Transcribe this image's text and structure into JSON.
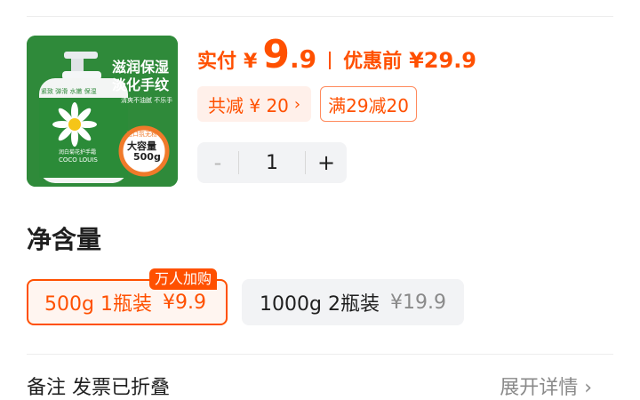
{
  "product": {
    "image_text": {
      "headline_1": "滋润保湿",
      "headline_2": "淡化手纹",
      "features": "紧致 弹滑 水嫩 保湿",
      "sub": "清爽不油腻 不乐手",
      "bottle_name": "润白菊花护手霜",
      "bottle_brand": "COCO LOUIS",
      "badge_top": "进口氛无粉",
      "badge_main": "大容量",
      "badge_size": "500g"
    }
  },
  "price": {
    "actual_label": "实付",
    "currency": "¥",
    "actual_int": "9",
    "actual_dec": ".9",
    "original_label": "优惠前",
    "original": "¥29.9"
  },
  "discounts": {
    "total": "共减 ¥ 20",
    "arrow": "›",
    "coupon": "满29减20"
  },
  "quantity": {
    "minus": "-",
    "value": "1",
    "plus": "+"
  },
  "spec": {
    "title": "净含量",
    "options": [
      {
        "label": "500g 1瓶装",
        "price": "¥9.9",
        "tag": "万人加购",
        "selected": true
      },
      {
        "label": "1000g 2瓶装",
        "price": "¥19.9",
        "selected": false
      }
    ]
  },
  "footer": {
    "notes": "备注 发票已折叠",
    "expand": "展开详情 ›"
  },
  "colors": {
    "accent": "#ff5000",
    "product_bg": "#2f8a3a"
  }
}
